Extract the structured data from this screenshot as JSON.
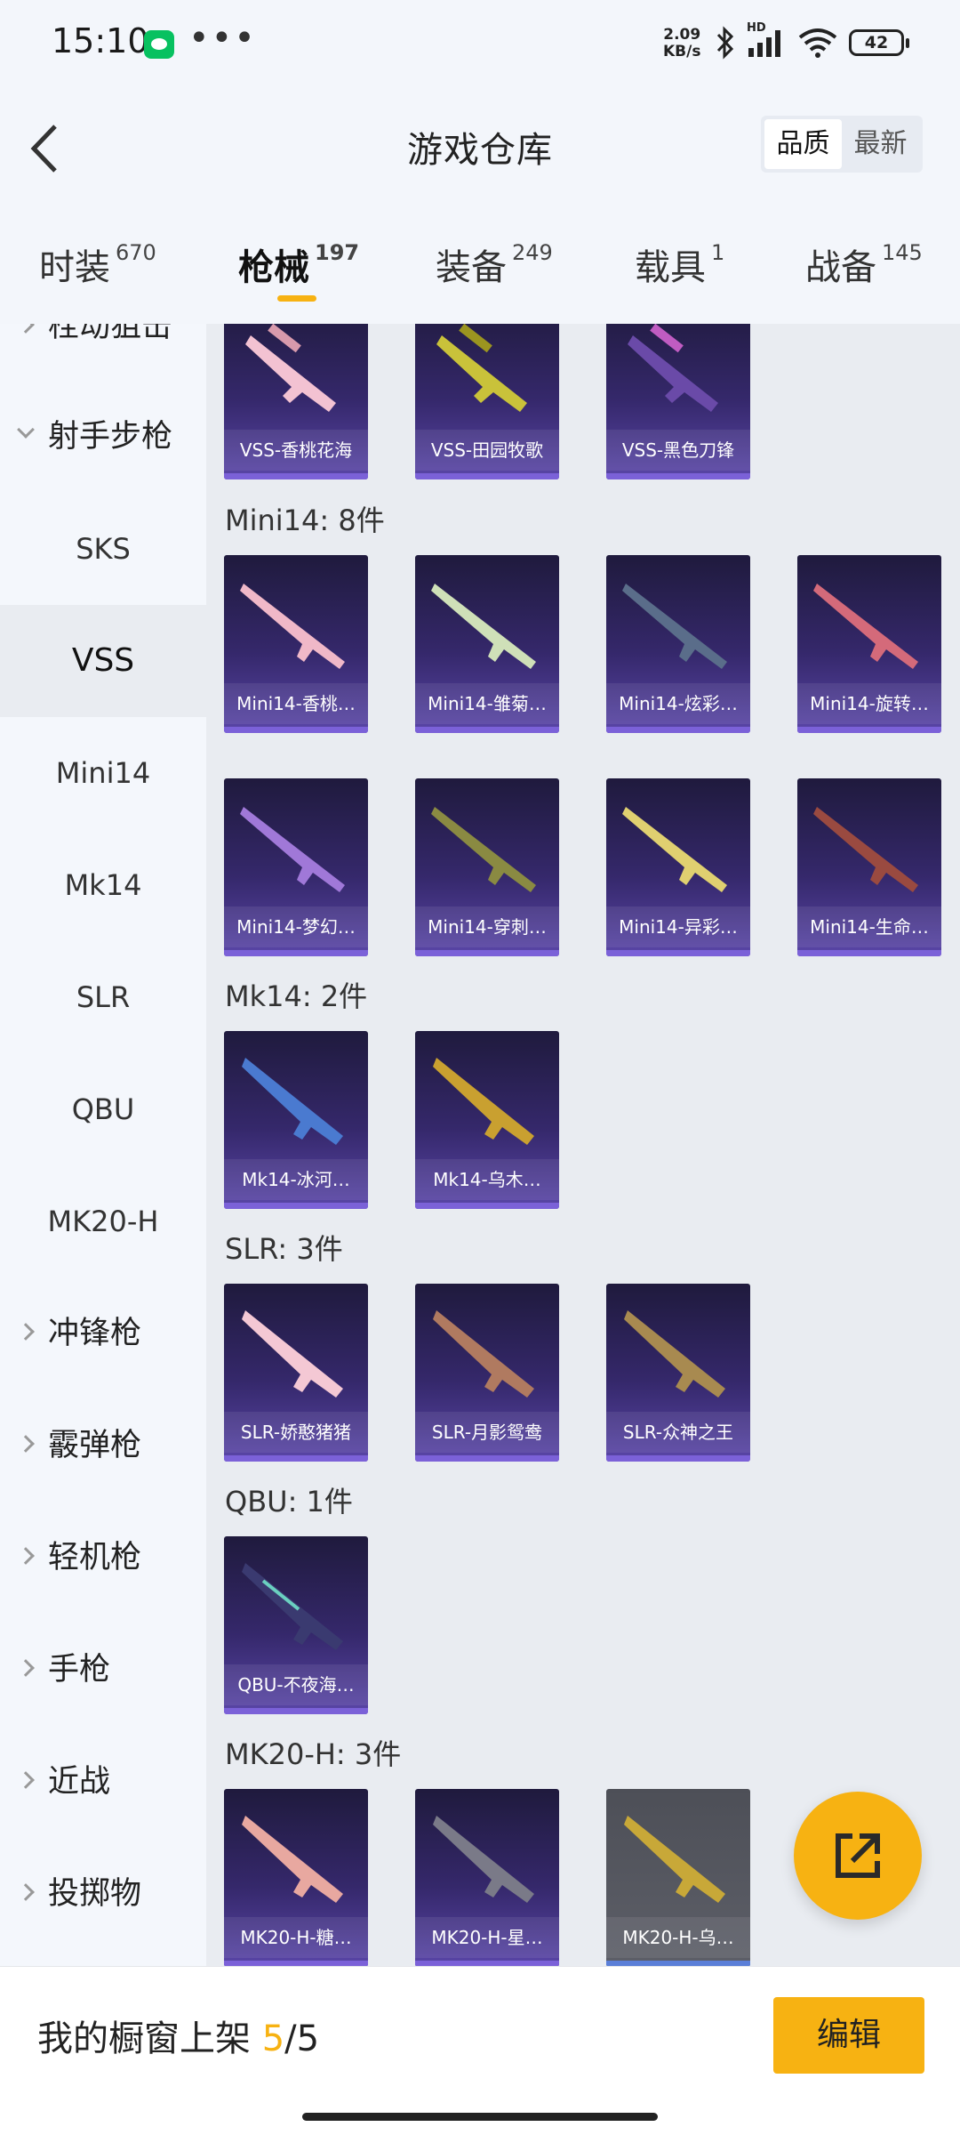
{
  "status_bar": {
    "time": "15:10",
    "dots": "•••",
    "net_speed_value": "2.09",
    "net_speed_unit": "KB/s",
    "hd": "HD",
    "battery": "42"
  },
  "header": {
    "title": "游戏仓库",
    "sort": {
      "quality": "品质",
      "latest": "最新"
    }
  },
  "tabs": [
    {
      "label": "时装",
      "count": "670"
    },
    {
      "label": "枪械",
      "count": "197"
    },
    {
      "label": "装备",
      "count": "249"
    },
    {
      "label": "载具",
      "count": "1"
    },
    {
      "label": "战备",
      "count": "145"
    }
  ],
  "sidebar": {
    "items": [
      {
        "label": "栓动狙击"
      },
      {
        "label": "射手步枪"
      },
      {
        "label": "SKS"
      },
      {
        "label": "VSS"
      },
      {
        "label": "Mini14"
      },
      {
        "label": "Mk14"
      },
      {
        "label": "SLR"
      },
      {
        "label": "QBU"
      },
      {
        "label": "MK20-H"
      },
      {
        "label": "冲锋枪"
      },
      {
        "label": "霰弹枪"
      },
      {
        "label": "轻机枪"
      },
      {
        "label": "手枪"
      },
      {
        "label": "近战"
      },
      {
        "label": "投掷物"
      }
    ]
  },
  "groups": [
    {
      "title": "",
      "items": [
        "VSS-香桃花海",
        "VSS-田园牧歌",
        "VSS-黑色刀锋"
      ]
    },
    {
      "title": "Mini14: 8件",
      "items": [
        "Mini14-香桃…",
        "Mini14-雏菊…",
        "Mini14-炫彩…",
        "Mini14-旋转…",
        "Mini14-梦幻…",
        "Mini14-穿刺…",
        "Mini14-异彩…",
        "Mini14-生命…"
      ]
    },
    {
      "title": "Mk14: 2件",
      "items": [
        "Mk14-冰河…",
        "Mk14-乌木…"
      ]
    },
    {
      "title": "SLR: 3件",
      "items": [
        "SLR-娇憨猪猪",
        "SLR-月影鸳鸯",
        "SLR-众神之王"
      ]
    },
    {
      "title": "QBU: 1件",
      "items": [
        "QBU-不夜海…"
      ]
    },
    {
      "title": "MK20-H: 3件",
      "items": [
        "MK20-H-糖…",
        "MK20-H-星…",
        "MK20-H-乌…"
      ]
    }
  ],
  "bottom": {
    "shelf_label": "我的橱窗上架",
    "shelf_current": "5",
    "shelf_total": "/5",
    "edit_label": "编辑"
  },
  "colors": {
    "accent": "#f7b212",
    "card_top": "#1f1a3d",
    "card_bottom": "#5a46a8"
  }
}
